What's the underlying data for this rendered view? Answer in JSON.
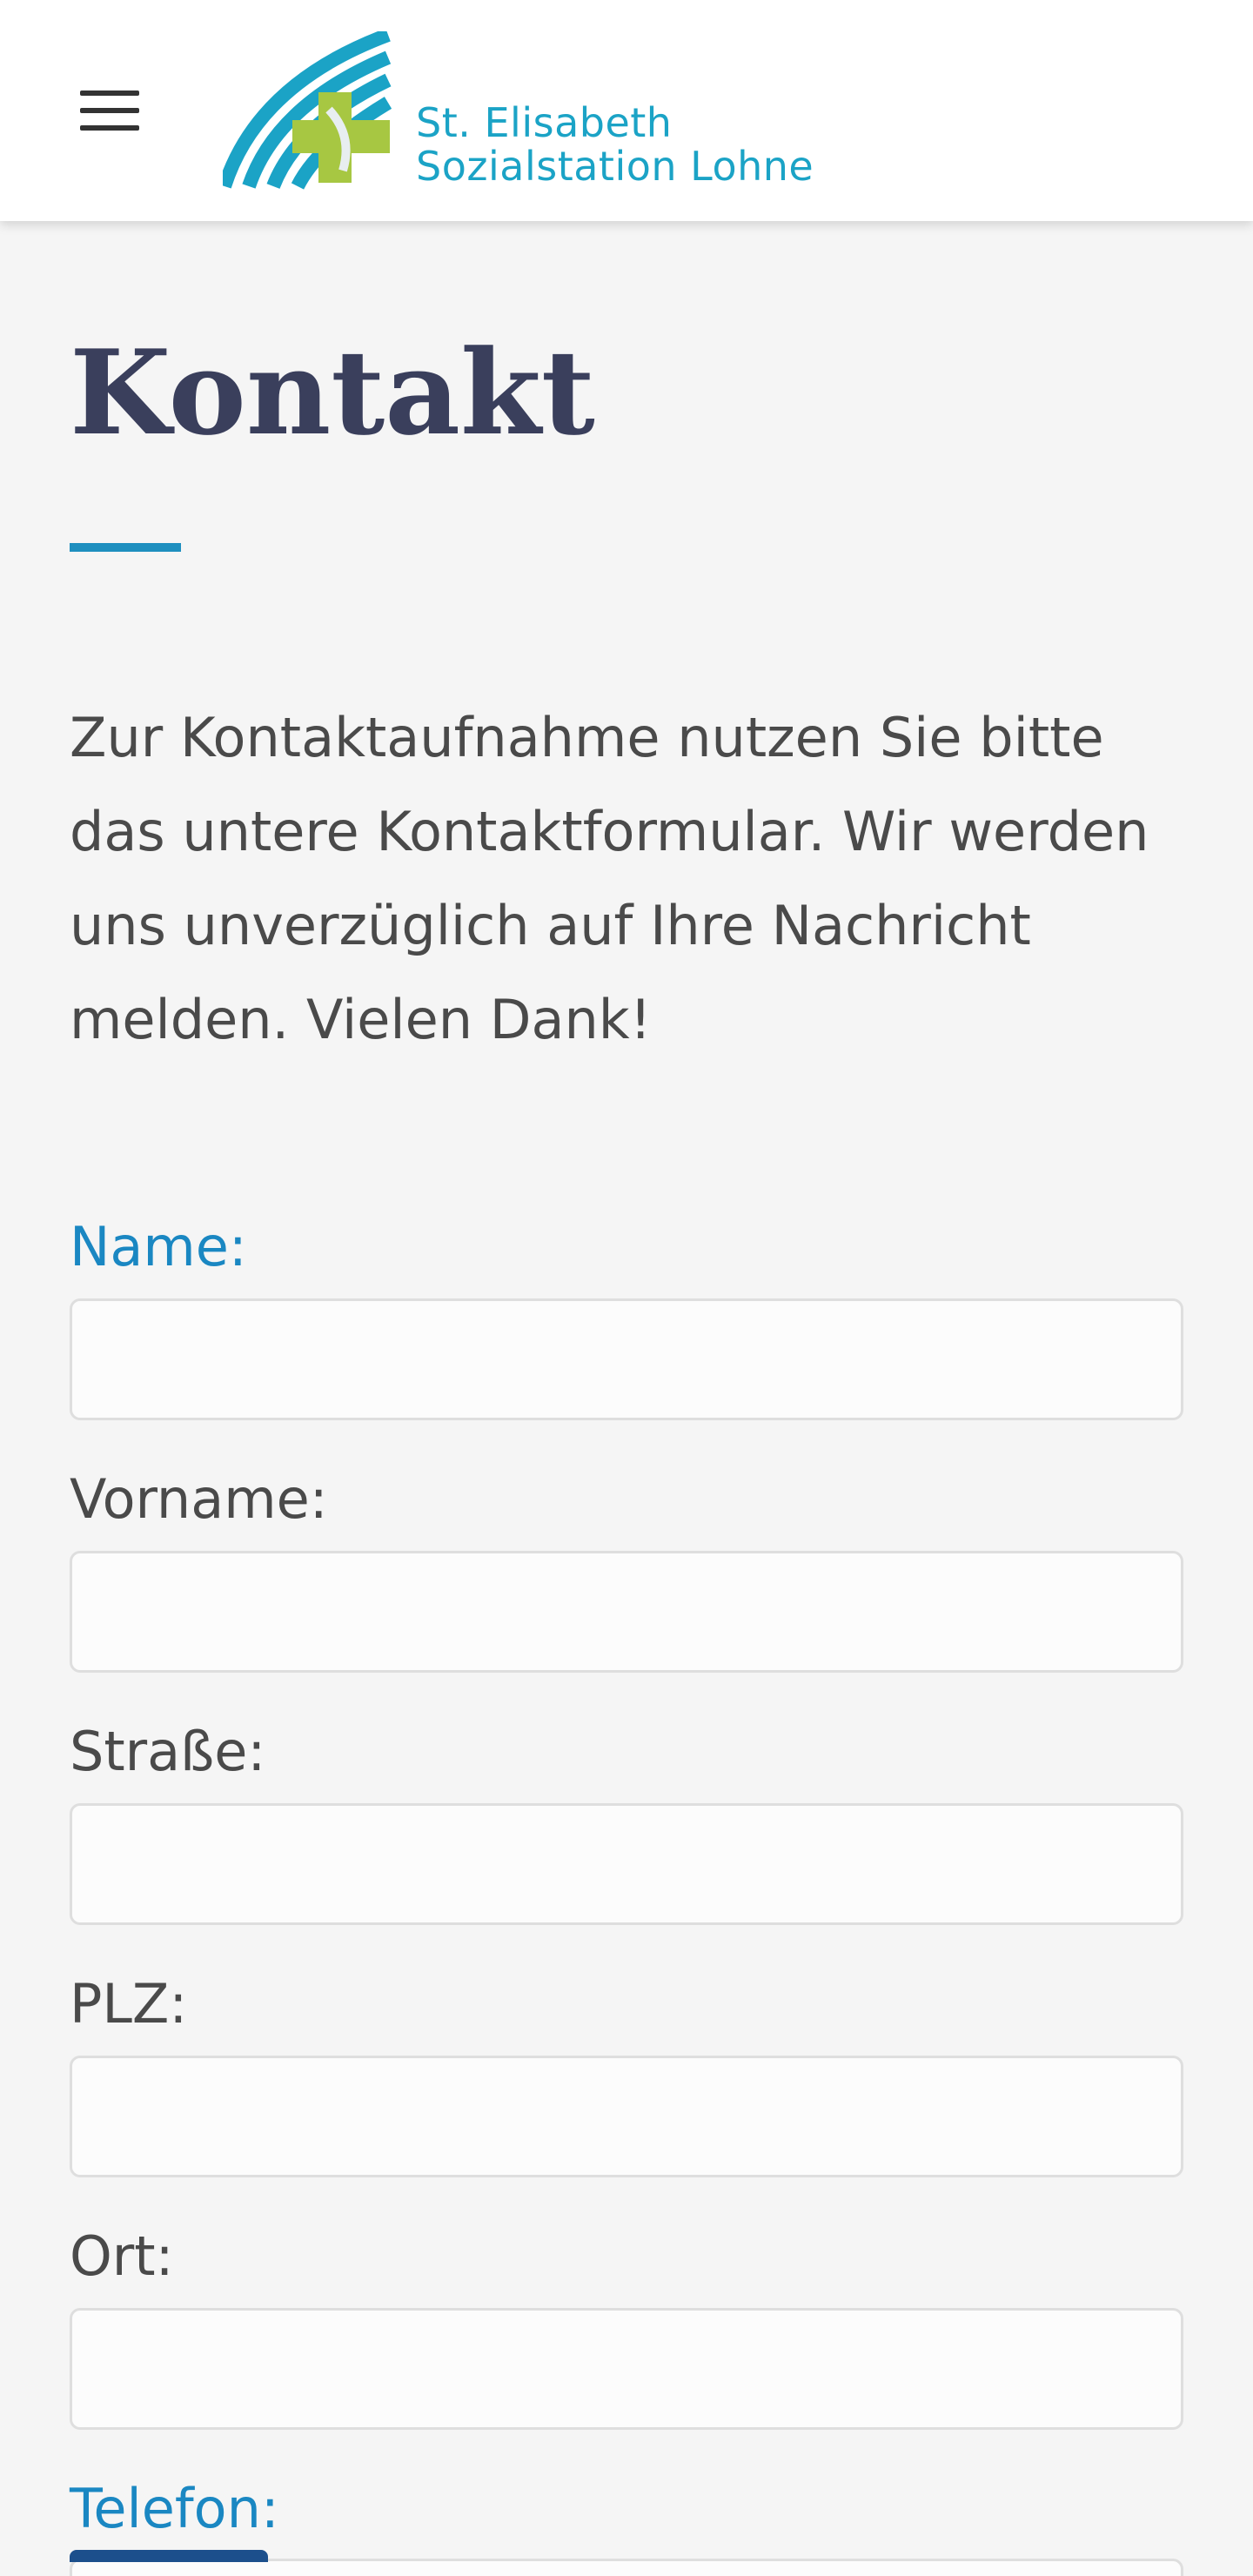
{
  "header": {
    "menu_icon": "hamburger-menu-icon",
    "logo": {
      "line1": "St. Elisabeth",
      "line2": "Sozialstation Lohne",
      "colors": {
        "arc": "#1ba3c6",
        "cross": "#a7c742"
      }
    }
  },
  "page": {
    "title": "Kontakt",
    "intro": "Zur Kontaktaufnahme nutzen Sie bitte das untere Kontaktformular. Wir werden uns unverzüglich auf Ihre Nachricht melden. Vielen Dank!"
  },
  "form": {
    "fields": [
      {
        "label": "Name:",
        "value": ""
      },
      {
        "label": "Vorname:",
        "value": ""
      },
      {
        "label": "Straße:",
        "value": ""
      },
      {
        "label": "PLZ:",
        "value": ""
      },
      {
        "label": "Ort:",
        "value": ""
      },
      {
        "label": "Telefon:",
        "value": ""
      }
    ]
  },
  "colors": {
    "accent": "#1a87c2",
    "title": "#3a3f5c",
    "text": "#4a4a4a",
    "background": "#f5f5f5"
  }
}
